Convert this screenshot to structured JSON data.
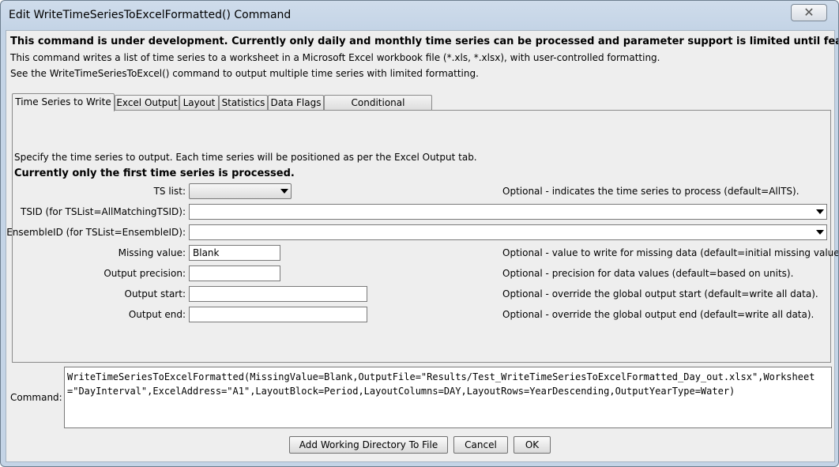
{
  "window": {
    "title": "Edit WriteTimeSeriesToExcelFormatted() Command",
    "close_glyph": "✕"
  },
  "header": {
    "warning": "This command is under development. Currently only daily and monthly time series can be processed and parameter support is limited until features are enabled.",
    "line1": "This command writes a list of time series to a worksheet in a Microsoft Excel workbook file (*.xls, *.xlsx), with user-controlled formatting.",
    "line2": "See the WriteTimeSeriesToExcel() command to output multiple time series with limited formatting."
  },
  "tabs": [
    {
      "label": "Time Series to Write",
      "active": true
    },
    {
      "label": "Excel Output",
      "active": false
    },
    {
      "label": "Layout",
      "active": false
    },
    {
      "label": "Statistics",
      "active": false
    },
    {
      "label": "Data Flags",
      "active": false
    },
    {
      "label": "Conditional Formatting",
      "active": false
    }
  ],
  "panel": {
    "intro": "Specify the time series to output.  Each time series will be positioned as per the Excel Output tab.",
    "bold_note": "Currently only the first time series is processed.",
    "ts_list_label": "TS list:",
    "ts_list_value": "",
    "ts_list_note": "Optional - indicates the time series to process (default=AllTS).",
    "tsid_label": "TSID (for TSList=AllMatchingTSID):",
    "tsid_value": "",
    "ensemble_label": "EnsembleID (for TSList=EnsembleID):",
    "ensemble_value": "",
    "missing_label": "Missing value:",
    "missing_value": "Blank",
    "missing_note": "Optional - value to write for missing data (default=initial missing value).",
    "precision_label": "Output precision:",
    "precision_value": "",
    "precision_note": "Optional - precision for data values (default=based on units).",
    "start_label": "Output start:",
    "start_value": "",
    "start_note": "Optional - override the global output start (default=write all data).",
    "end_label": "Output end:",
    "end_value": "",
    "end_note": "Optional - override the global output end (default=write all data)."
  },
  "command": {
    "label": "Command:",
    "text": "WriteTimeSeriesToExcelFormatted(MissingValue=Blank,OutputFile=\"Results/Test_WriteTimeSeriesToExcelFormatted_Day_out.xlsx\",Worksheet=\"DayInterval\",ExcelAddress=\"A1\",LayoutBlock=Period,LayoutColumns=DAY,LayoutRows=YearDescending,OutputYearType=Water)"
  },
  "buttons": {
    "add_wd": "Add Working Directory To File",
    "cancel": "Cancel",
    "ok": "OK"
  }
}
